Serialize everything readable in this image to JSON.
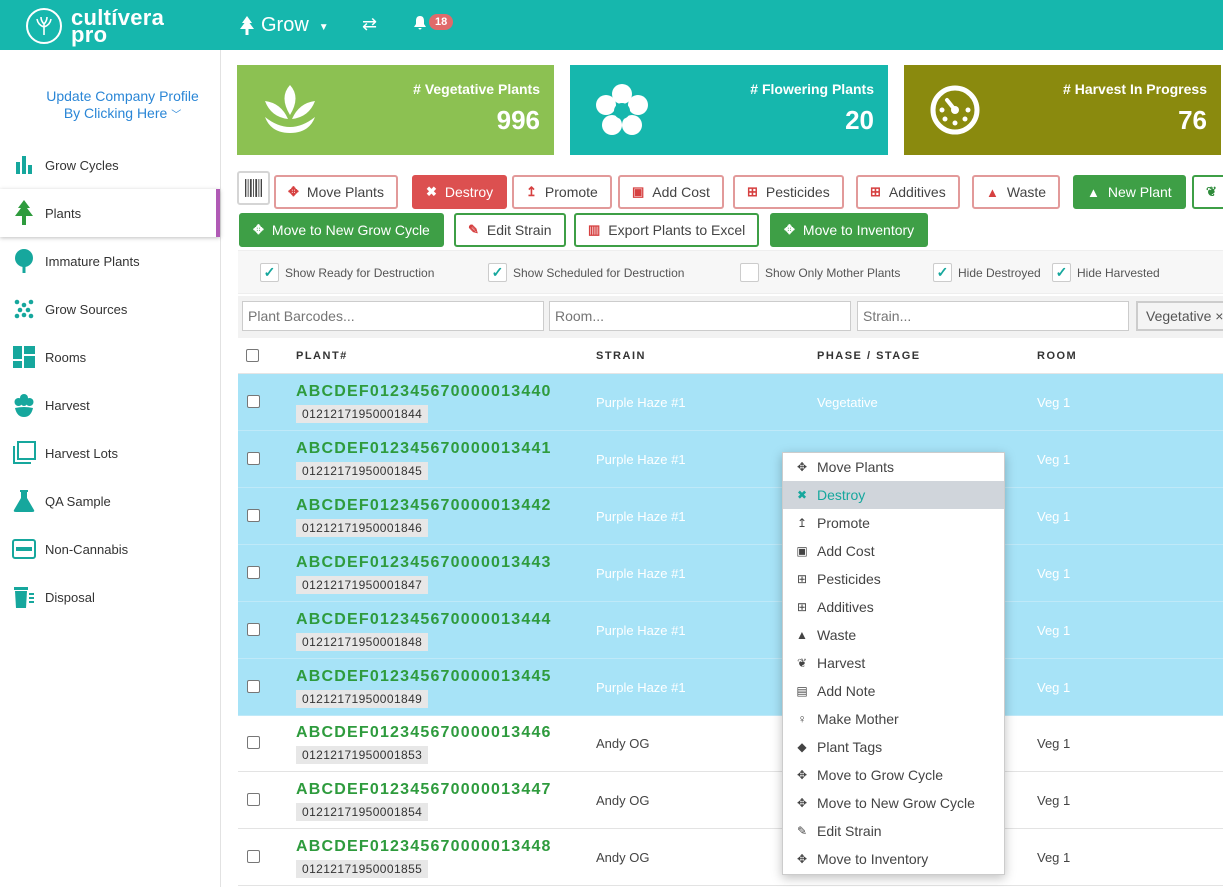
{
  "app": {
    "logo_line1": "cultívera",
    "logo_line2": "pro",
    "module": "Grow",
    "notifications": "18"
  },
  "sidebar": {
    "company_line1": "Update Company Profile",
    "company_line2": "By Clicking Here",
    "items": [
      {
        "label": "Grow Cycles",
        "icon": "bar-chart-icon"
      },
      {
        "label": "Plants",
        "icon": "tree-icon",
        "active": true
      },
      {
        "label": "Immature Plants",
        "icon": "sapling-icon"
      },
      {
        "label": "Grow Sources",
        "icon": "dots-icon"
      },
      {
        "label": "Rooms",
        "icon": "rooms-icon"
      },
      {
        "label": "Harvest",
        "icon": "flower-icon"
      },
      {
        "label": "Harvest Lots",
        "icon": "layers-icon"
      },
      {
        "label": "QA Sample",
        "icon": "flask-icon"
      },
      {
        "label": "Non-Cannabis",
        "icon": "card-icon"
      },
      {
        "label": "Disposal",
        "icon": "trash-icon"
      }
    ]
  },
  "stats": [
    {
      "label": "# Vegetative Plants",
      "value": "996",
      "color": "#8cc152"
    },
    {
      "label": "# Flowering Plants",
      "value": "20",
      "color": "#16b7ad"
    },
    {
      "label": "# Harvest In Progress",
      "value": "76",
      "color": "#8a8a0e"
    }
  ],
  "toolbar": {
    "row1": [
      "Move Plants",
      "Destroy",
      "Promote",
      "Add Cost",
      "Pesticides",
      "Additives",
      "Waste",
      "New Plant"
    ],
    "row2": [
      "Move to New Grow Cycle",
      "Edit Strain",
      "Export Plants to Excel",
      "Move to Inventory"
    ]
  },
  "filters": [
    {
      "label": "Show Ready for Destruction",
      "checked": true
    },
    {
      "label": "Show Scheduled for Destruction",
      "checked": true
    },
    {
      "label": "Show Only Mother Plants",
      "checked": false
    },
    {
      "label": "Hide Destroyed",
      "checked": true
    },
    {
      "label": "Hide Harvested",
      "checked": true
    }
  ],
  "search": {
    "barcodes_placeholder": "Plant Barcodes...",
    "room_placeholder": "Room...",
    "strain_placeholder": "Strain...",
    "phase_tag": "Vegetative ×"
  },
  "table": {
    "headers": [
      "PLANT#",
      "STRAIN",
      "PHASE / STAGE",
      "ROOM"
    ],
    "rows": [
      {
        "plant": "ABCDEF012345670000013440",
        "barcode": "01212171950001844",
        "strain": "Purple Haze #1",
        "phase": "Vegetative",
        "room": "Veg 1",
        "selected": true
      },
      {
        "plant": "ABCDEF012345670000013441",
        "barcode": "01212171950001845",
        "strain": "Purple Haze #1",
        "phase": "",
        "room": "Veg 1",
        "selected": true
      },
      {
        "plant": "ABCDEF012345670000013442",
        "barcode": "01212171950001846",
        "strain": "Purple Haze #1",
        "phase": "",
        "room": "Veg 1",
        "selected": true
      },
      {
        "plant": "ABCDEF012345670000013443",
        "barcode": "01212171950001847",
        "strain": "Purple Haze #1",
        "phase": "",
        "room": "Veg 1",
        "selected": true
      },
      {
        "plant": "ABCDEF012345670000013444",
        "barcode": "01212171950001848",
        "strain": "Purple Haze #1",
        "phase": "",
        "room": "Veg 1",
        "selected": true
      },
      {
        "plant": "ABCDEF012345670000013445",
        "barcode": "01212171950001849",
        "strain": "Purple Haze #1",
        "phase": "",
        "room": "Veg 1",
        "selected": true
      },
      {
        "plant": "ABCDEF012345670000013446",
        "barcode": "01212171950001853",
        "strain": "Andy OG",
        "phase": "",
        "room": "Veg 1",
        "selected": false
      },
      {
        "plant": "ABCDEF012345670000013447",
        "barcode": "01212171950001854",
        "strain": "Andy OG",
        "phase": "",
        "room": "Veg 1",
        "selected": false
      },
      {
        "plant": "ABCDEF012345670000013448",
        "barcode": "01212171950001855",
        "strain": "Andy OG",
        "phase": "",
        "room": "Veg 1",
        "selected": false
      }
    ]
  },
  "context_menu": [
    {
      "label": "Move Plants",
      "icon": "move-icon",
      "glyph": "✥"
    },
    {
      "label": "Destroy",
      "icon": "times-icon",
      "glyph": "✖",
      "highlight": true
    },
    {
      "label": "Promote",
      "icon": "level-up-icon",
      "glyph": "↥"
    },
    {
      "label": "Add Cost",
      "icon": "money-icon",
      "glyph": "▣"
    },
    {
      "label": "Pesticides",
      "icon": "plus-square-icon",
      "glyph": "⊞"
    },
    {
      "label": "Additives",
      "icon": "plus-square-icon",
      "glyph": "⊞"
    },
    {
      "label": "Waste",
      "icon": "warning-icon",
      "glyph": "▲"
    },
    {
      "label": "Harvest",
      "icon": "leaf-icon",
      "glyph": "❦"
    },
    {
      "label": "Add Note",
      "icon": "file-icon",
      "glyph": "▤"
    },
    {
      "label": "Make Mother",
      "icon": "female-icon",
      "glyph": "♀"
    },
    {
      "label": "Plant Tags",
      "icon": "tags-icon",
      "glyph": "◆"
    },
    {
      "label": "Move to Grow Cycle",
      "icon": "move-icon",
      "glyph": "✥"
    },
    {
      "label": "Move to New Grow Cycle",
      "icon": "move-icon",
      "glyph": "✥"
    },
    {
      "label": "Edit Strain",
      "icon": "pencil-icon",
      "glyph": "✎"
    },
    {
      "label": "Move to Inventory",
      "icon": "move-icon",
      "glyph": "✥"
    }
  ]
}
